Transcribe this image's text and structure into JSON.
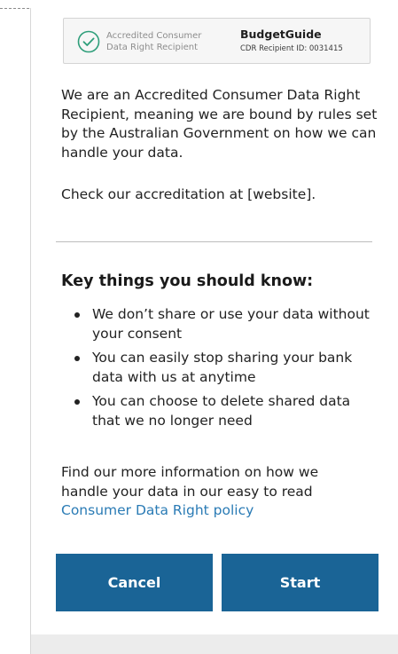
{
  "badge": {
    "accredited_line1": "Accredited Consumer",
    "accredited_line2": "Data Right Recipient",
    "brand": "BudgetGuide",
    "cdr_id": "CDR Recipient ID: 0031415",
    "icon": "check-circle-icon"
  },
  "intro": "We are an Accredited Consumer Data Right Recipient, meaning we are bound by rules set by the Australian Government on how we can handle your data.",
  "accreditation_check": "Check our accreditation at [website].",
  "key_things": {
    "title": "Key things you should know:",
    "items": [
      "We don’t share or use your data without your consent",
      "You can easily stop sharing your bank data with us at anytime",
      "You can choose to delete shared data that we no longer need"
    ]
  },
  "more_info": {
    "text": "Find our more information on how we handle your data in our easy to read ",
    "link": "Consumer Data Right policy"
  },
  "buttons": {
    "cancel": "Cancel",
    "start": "Start"
  },
  "colors": {
    "primary_button": "#1a6496",
    "link": "#2a7bb5",
    "check_icon": "#2e9e7a"
  }
}
